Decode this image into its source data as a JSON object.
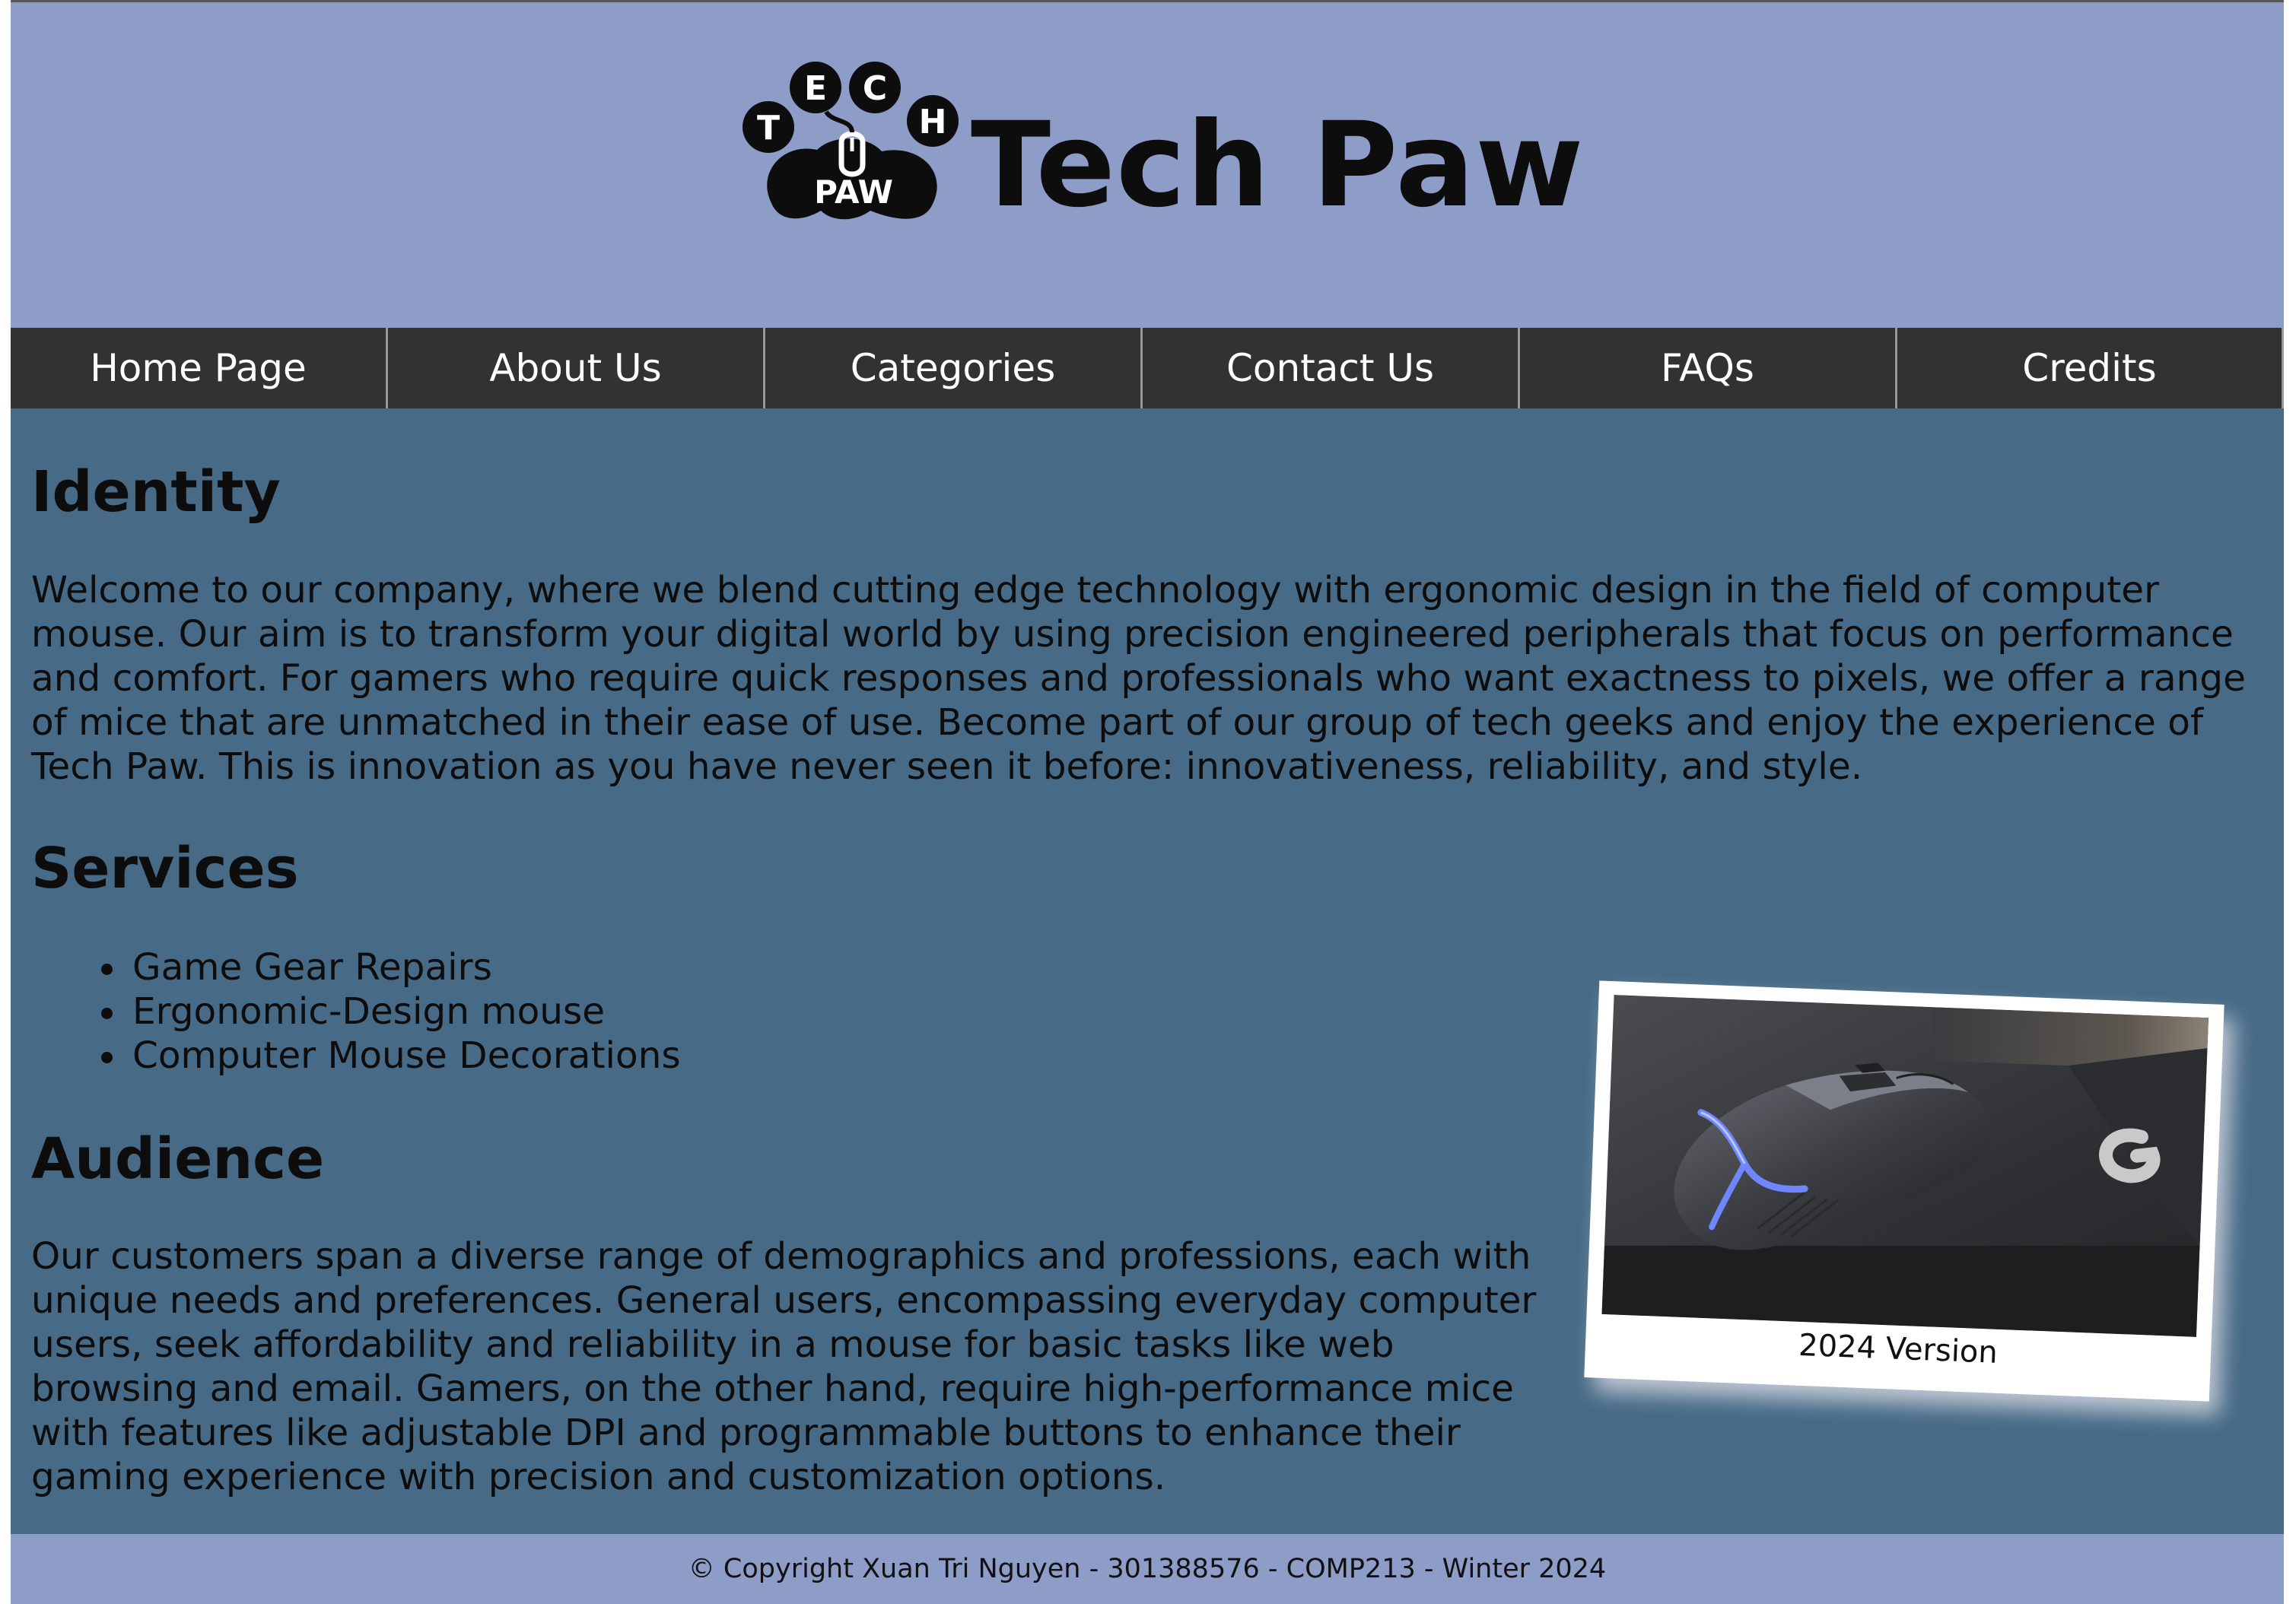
{
  "header": {
    "logo_letters": [
      "T",
      "E",
      "C",
      "H"
    ],
    "logo_paw_text": "PAW",
    "title": "Tech Paw"
  },
  "nav": {
    "items": [
      {
        "label": "Home Page"
      },
      {
        "label": "About Us"
      },
      {
        "label": "Categories"
      },
      {
        "label": "Contact Us"
      },
      {
        "label": "FAQs"
      },
      {
        "label": "Credits"
      }
    ]
  },
  "main": {
    "identity": {
      "heading": "Identity",
      "text": "Welcome to our company, where we blend cutting edge technology with ergonomic design in the field of computer mouse. Our aim is to transform your digital world by using precision engineered peripherals that focus on performance and comfort. For gamers who require quick responses and professionals who want exactness to pixels, we offer a range of mice that are unmatched in their ease of use. Become part of our group of tech geeks and enjoy the experience of Tech Paw. This is innovation as you have never seen it before: innovativeness, reliability, and style."
    },
    "services": {
      "heading": "Services",
      "items": [
        "Game Gear Repairs",
        "Ergonomic-Design mouse",
        "Computer Mouse Decorations"
      ]
    },
    "audience": {
      "heading": "Audience",
      "text": "Our customers span a diverse range of demographics and professions, each with unique needs and preferences. General users, encompassing everyday computer users, seek affordability and reliability in a mouse for basic tasks like web browsing and email. Gamers, on the other hand, require high-performance mice with features like adjustable DPI and programmable buttons to enhance their gaming experience with precision and customization options."
    },
    "photo": {
      "caption": "2024 Version",
      "icon": "gaming-mouse-photo"
    }
  },
  "footer": {
    "text": "© Copyright Xuan Tri Nguyen - 301388576 - COMP213 - Winter 2024"
  },
  "colors": {
    "header_bg": "#8e9cc8",
    "nav_bg": "#323232",
    "main_bg": "#476a86",
    "footer_bg": "#8e9cc8",
    "mouse_accent": "#6f86ff"
  }
}
